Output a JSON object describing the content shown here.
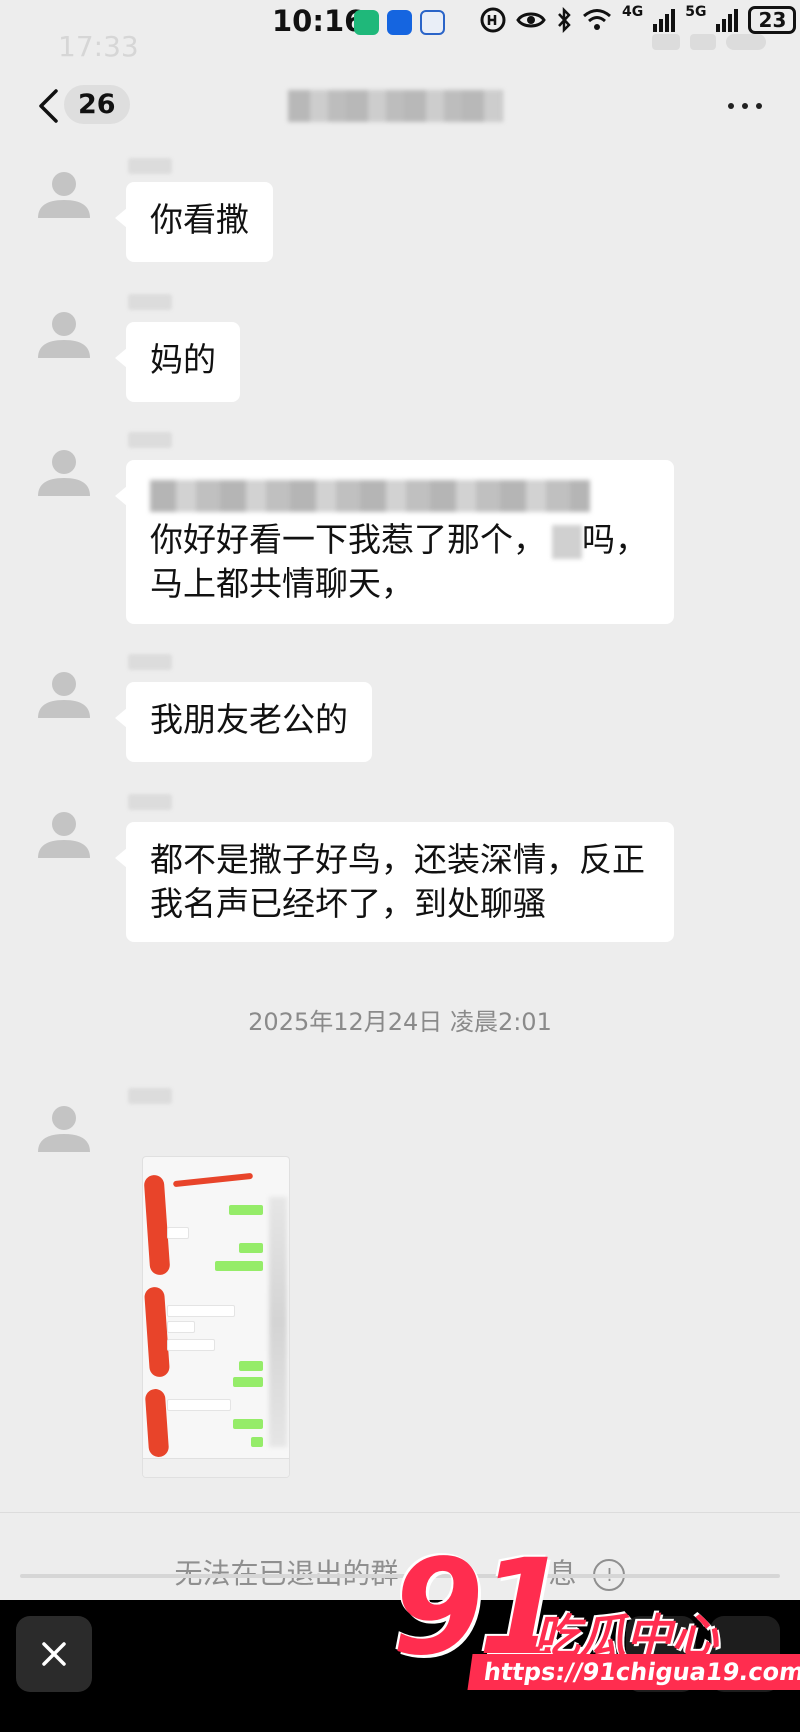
{
  "status_bar": {
    "time": "10:16",
    "battery": "23",
    "network_labels": [
      "4G",
      "5G"
    ]
  },
  "underlay_status": {
    "time": "17:33"
  },
  "nav": {
    "unread_count": "26"
  },
  "messages": [
    {
      "text": "你看撒"
    },
    {
      "text": "妈的"
    },
    {
      "line2": "你好好看一下我惹了那个，",
      "line2_tail": "吗，",
      "line3": "马上都共情聊天，"
    },
    {
      "text": "我朋友老公的"
    },
    {
      "line1": "都不是撒子好鸟，还装深情，反正",
      "line2": "我名声已经坏了，到处聊骚"
    }
  ],
  "timestamp": "2025年12月24日 凌晨2:01",
  "footer": {
    "notice_head": "无法在已退出的群",
    "notice_tail": "息"
  },
  "watermark": {
    "number": "91",
    "name": "吃瓜中心",
    "url": "https://91chigua19.com"
  },
  "colors": {
    "background": "#ededed",
    "bubble": "#ffffff",
    "brand": "#ff2d4f",
    "scribble": "#e8442a"
  },
  "icons": [
    "back-icon",
    "more-icon",
    "avatar-icon",
    "info-icon",
    "close-icon"
  ]
}
